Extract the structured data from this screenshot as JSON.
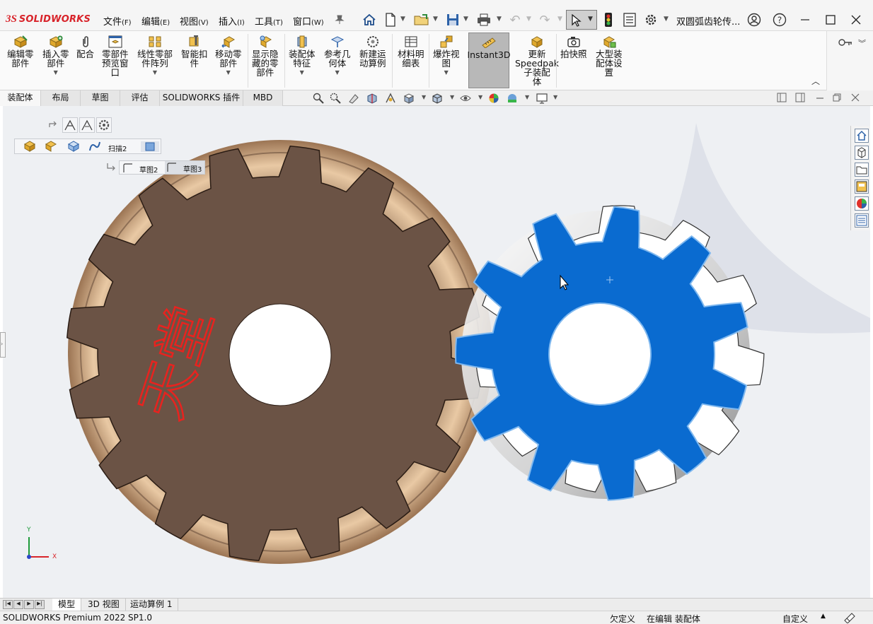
{
  "app": {
    "logo_mark": "3S",
    "brand": "SOLIDWORKS",
    "document_title": "双圆弧齿轮传..."
  },
  "menu": [
    {
      "label": "文件",
      "key": "(F)"
    },
    {
      "label": "编辑",
      "key": "(E)"
    },
    {
      "label": "视图",
      "key": "(V)"
    },
    {
      "label": "插入",
      "key": "(I)"
    },
    {
      "label": "工具",
      "key": "(T)"
    },
    {
      "label": "窗口",
      "key": "(W)"
    }
  ],
  "ribbon": {
    "buttons": [
      {
        "label": "编辑零\n部件"
      },
      {
        "label": "插入零\n部件"
      },
      {
        "label": "配合"
      },
      {
        "label": "零部件\n预览窗\n口"
      },
      {
        "label": "线性零部\n件阵列"
      },
      {
        "label": "智能扣\n件"
      },
      {
        "label": "移动零\n部件"
      },
      {
        "label": "显示隐\n藏的零\n部件"
      },
      {
        "label": "装配体\n特征"
      },
      {
        "label": "参考几\n何体"
      },
      {
        "label": "新建运\n动算例"
      },
      {
        "label": "材料明\n细表"
      },
      {
        "label": "爆炸视\n图"
      },
      {
        "label": "Instant3D"
      },
      {
        "label": "更新\nSpeedpak\n子装配\n体"
      },
      {
        "label": "拍快照"
      },
      {
        "label": "大型装\n配体设\n置"
      }
    ]
  },
  "tabs": [
    {
      "label": "装配体",
      "active": true
    },
    {
      "label": "布局"
    },
    {
      "label": "草图"
    },
    {
      "label": "评估"
    },
    {
      "label": "SOLIDWORKS 插件"
    },
    {
      "label": "MBD"
    }
  ],
  "breadcrumb": {
    "feature": "扫描2",
    "sketches": [
      "草图2",
      "草图3"
    ]
  },
  "annotation": {
    "text": "天堂",
    "color": "#e8231f"
  },
  "colors": {
    "large_gear_face": "#6b5345",
    "large_gear_rim": "#c8a07c",
    "small_gear_face": "#0a6bd0",
    "small_gear_edge": "#7fb8ef",
    "viewport_bg": "#eef0f3",
    "triad_x": "#d9252a",
    "triad_y": "#1e9a3a",
    "triad_z": "#2a46c8"
  },
  "triad": {
    "x": "X",
    "y": "Y"
  },
  "bottom_tabs": [
    {
      "label": "模型",
      "active": true
    },
    {
      "label": "3D 视图"
    },
    {
      "label": "运动算例 1"
    }
  ],
  "status": {
    "product": "SOLIDWORKS Premium 2022 SP1.0",
    "definition": "欠定义",
    "mode": "在编辑 装配体",
    "units": "自定义"
  }
}
